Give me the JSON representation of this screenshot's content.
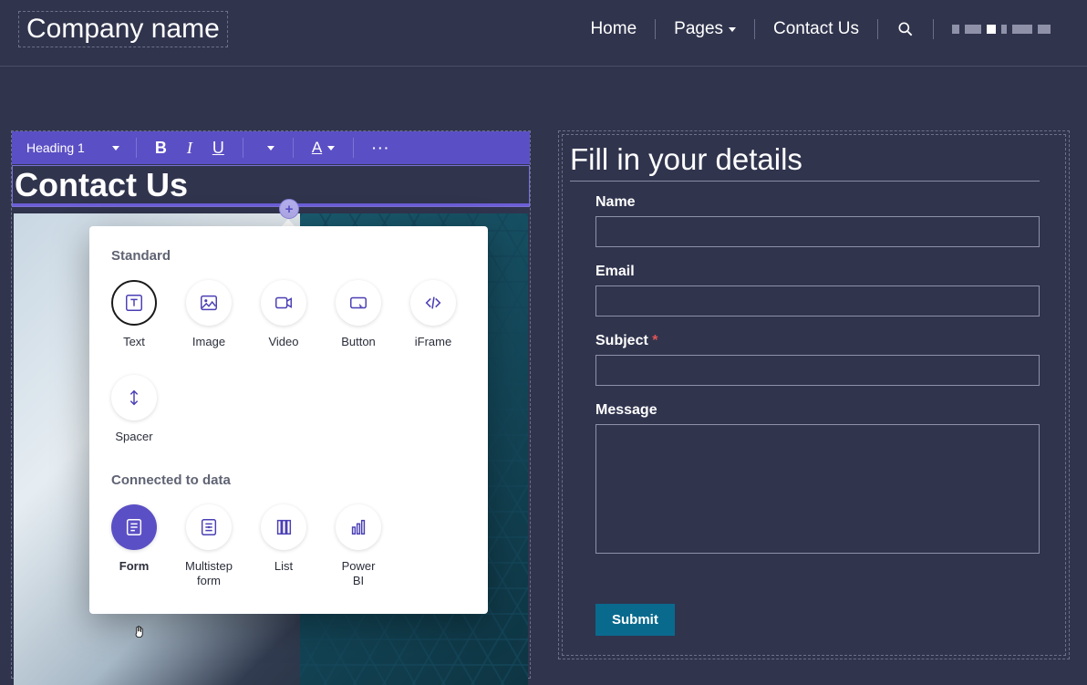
{
  "header": {
    "company": "Company name",
    "nav": {
      "home": "Home",
      "pages": "Pages",
      "contact": "Contact Us"
    }
  },
  "left": {
    "toolbar": {
      "style_select": "Heading 1"
    },
    "heading": "Contact Us"
  },
  "picker": {
    "section_standard": "Standard",
    "section_connected": "Connected to data",
    "items_standard": [
      {
        "label": "Text",
        "icon": "text"
      },
      {
        "label": "Image",
        "icon": "image"
      },
      {
        "label": "Video",
        "icon": "video"
      },
      {
        "label": "Button",
        "icon": "button"
      },
      {
        "label": "iFrame",
        "icon": "iframe"
      },
      {
        "label": "Spacer",
        "icon": "spacer"
      }
    ],
    "items_connected": [
      {
        "label": "Form",
        "icon": "form"
      },
      {
        "label": "Multistep form",
        "icon": "multistep"
      },
      {
        "label": "List",
        "icon": "list"
      },
      {
        "label": "Power BI",
        "icon": "powerbi"
      }
    ]
  },
  "form": {
    "title": "Fill in your details",
    "labels": {
      "name": "Name",
      "email": "Email",
      "subject": "Subject",
      "message": "Message"
    },
    "required_marker": "*",
    "submit": "Submit"
  }
}
